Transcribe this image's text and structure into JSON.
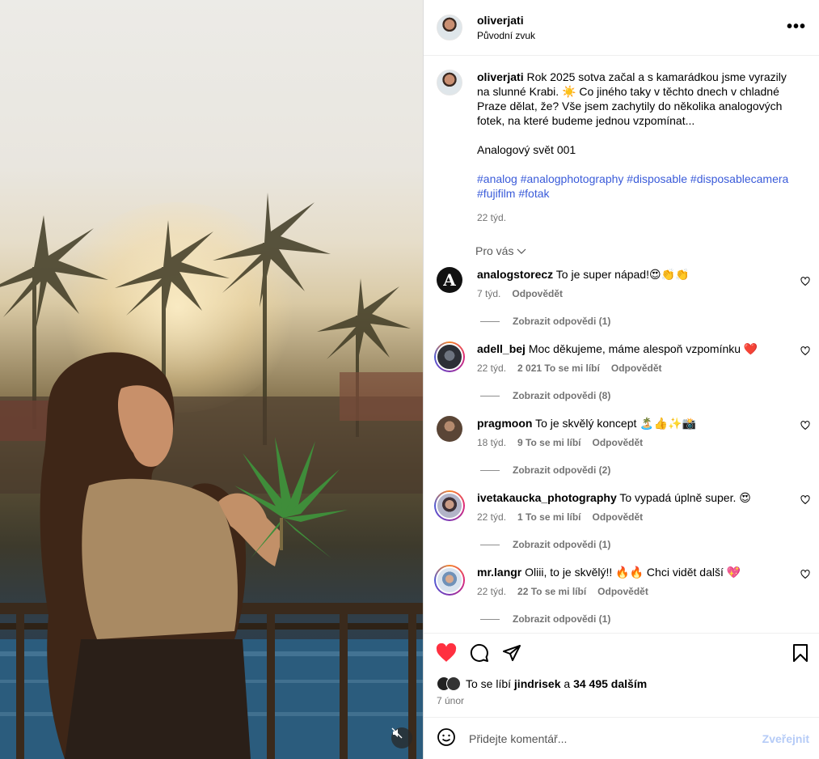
{
  "post": {
    "username": "oliverjati",
    "audio": "Původní zvuk",
    "more_label": "•••"
  },
  "caption": {
    "username": "oliverjati",
    "text": "Rok 2025 sotva začal a s kamarádkou jsme vyrazily na slunné Krabi. ☀️ Co jiného taky v těchto dnech v chladné Praze dělat, že? Vše jsem zachytily do několika analogových fotek, na které budeme jednou vzpomínat...",
    "line2": "Analogový svět 001",
    "tags": [
      "#analog",
      "#analogphotography",
      "#disposable",
      "#disposablecamera",
      "#fujifilm",
      "#fotak"
    ],
    "age": "22 týd."
  },
  "sort_label": "Pro vás",
  "comments": [
    {
      "username": "analogstorecz",
      "text": "To je super nápad!😍👏👏",
      "age": "7 týd.",
      "likes": "",
      "reply": "Odpovědět",
      "view_replies": "Zobrazit odpovědi (1)"
    },
    {
      "username": "adell_bej",
      "text": "Moc děkujeme, máme alespoň vzpomínku ❤️",
      "age": "22 týd.",
      "likes": "2 021 To se mi líbí",
      "reply": "Odpovědět",
      "view_replies": "Zobrazit odpovědi (8)"
    },
    {
      "username": "pragmoon",
      "text": "To je skvělý koncept 🏝️👍✨📸",
      "age": "18 týd.",
      "likes": "9 To se mi líbí",
      "reply": "Odpovědět",
      "view_replies": "Zobrazit odpovědi (2)"
    },
    {
      "username": "ivetakaucka_photography",
      "text": "To vypadá úplně super. 😍",
      "age": "22 týd.",
      "likes": "1 To se mi líbí",
      "reply": "Odpovědět",
      "view_replies": "Zobrazit odpovědi (1)"
    },
    {
      "username": "mr.langr",
      "text": "Oliii, to je skvělý!! 🔥🔥 Chci vidět další 💖",
      "age": "22 týd.",
      "likes": "22 To se mi líbí",
      "reply": "Odpovědět",
      "view_replies": "Zobrazit odpovědi (1)"
    }
  ],
  "likes": {
    "prefix": "To se líbí",
    "user": "jindrisek",
    "and": "a",
    "others": "34 495 dalším"
  },
  "date": "7 únor",
  "add_comment": {
    "placeholder": "Přidejte komentář...",
    "post_label": "Zveřejnit"
  },
  "colors": {
    "link": "#3a5bd9",
    "heart": "#ff3040",
    "muted": "#737373"
  }
}
